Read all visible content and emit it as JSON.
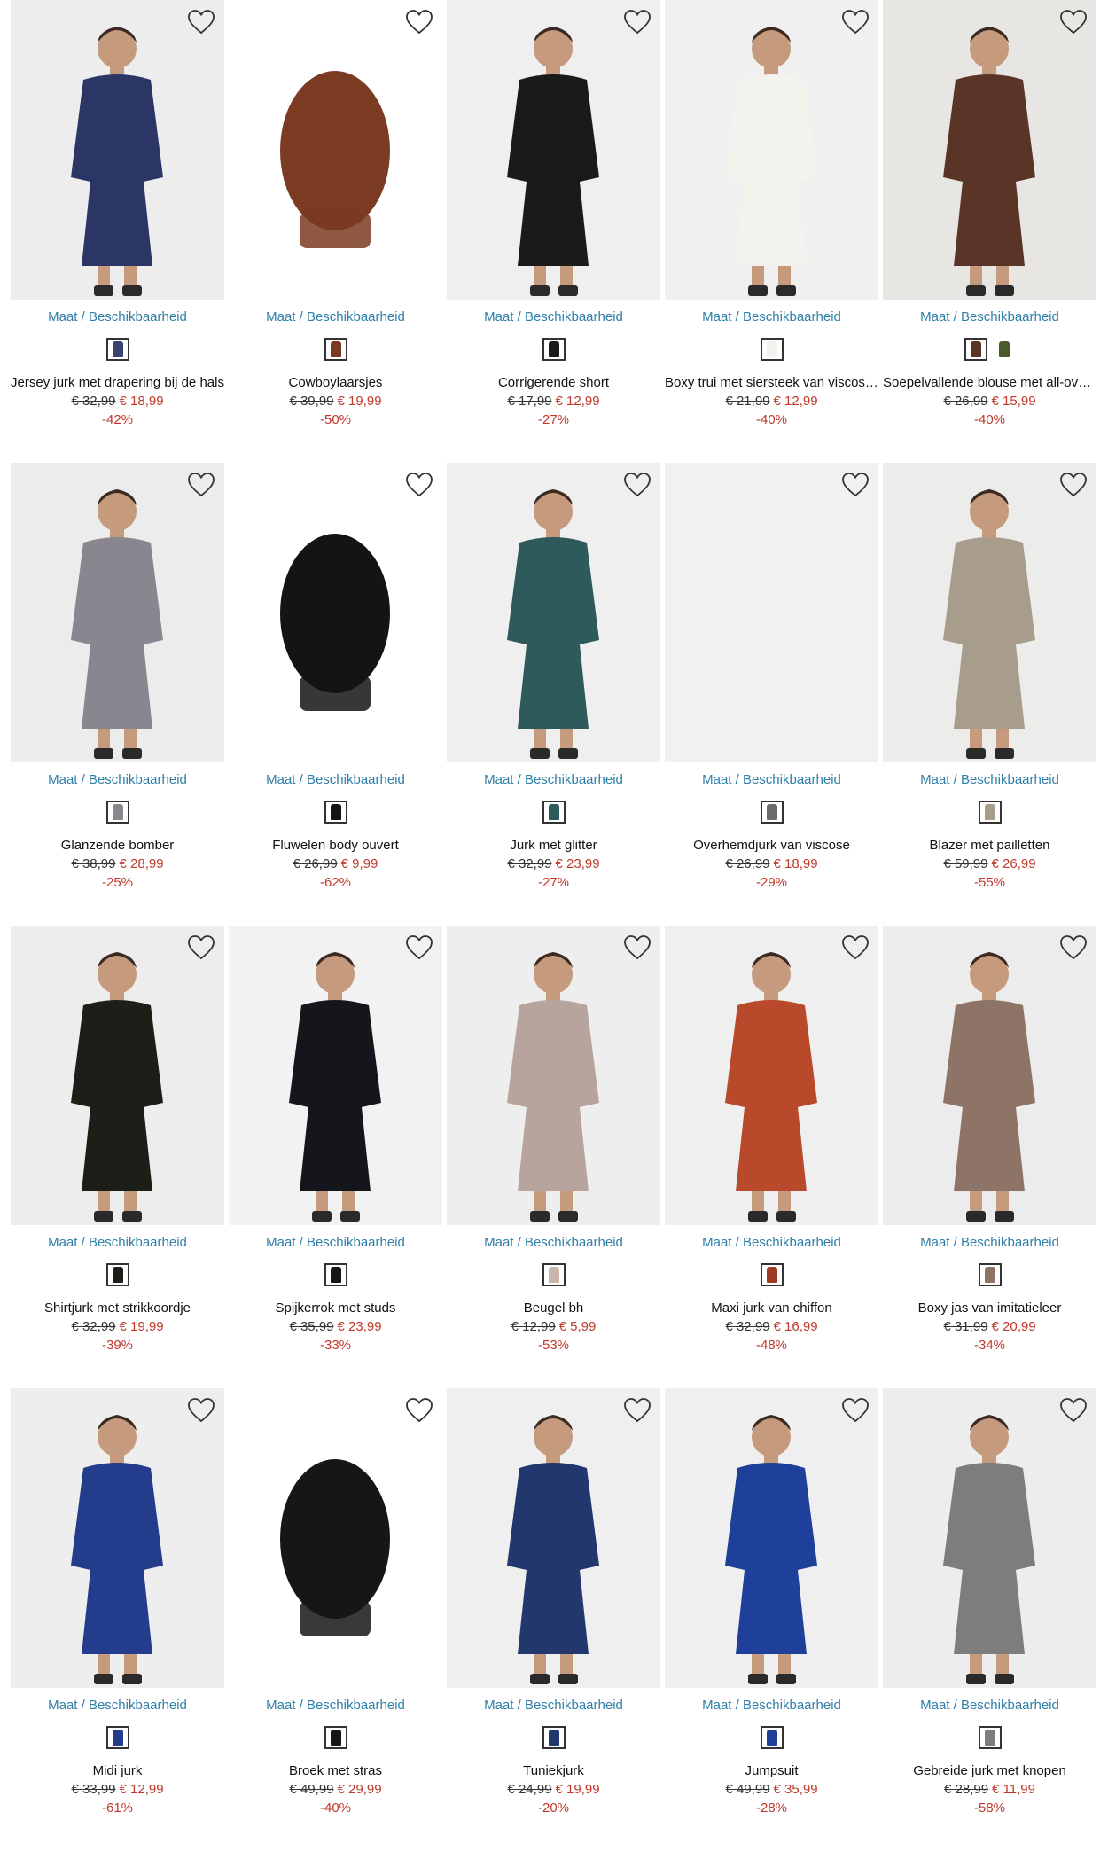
{
  "size_link_label": "Maat / Beschikbaarheid",
  "colors": {
    "link": "#2f7fa8",
    "price_new": "#c0392b",
    "discount": "#c0392b"
  },
  "icons": {
    "favorite": "heart-outline-icon"
  },
  "products": [
    {
      "name": "Jersey jurk met drapering bij de hals",
      "old_price": "€ 32,99",
      "new_price": "€ 18,99",
      "discount": "-42%",
      "image_bg": "#ededed",
      "garment": "#2b3566",
      "swatches": [
        "#3b4470"
      ]
    },
    {
      "name": "Cowboylaarsjes",
      "old_price": "€ 39,99",
      "new_price": "€ 19,99",
      "discount": "-50%",
      "image_bg": "#ffffff",
      "garment": "#7a3b22",
      "swatches": [
        "#7a3b22"
      ]
    },
    {
      "name": "Corrigerende short",
      "old_price": "€ 17,99",
      "new_price": "€ 12,99",
      "discount": "-27%",
      "image_bg": "#efefef",
      "garment": "#1a1a1a",
      "swatches": [
        "#1a1a1a"
      ]
    },
    {
      "name": "Boxy trui met siersteek van viscose...",
      "old_price": "€ 21,99",
      "new_price": "€ 12,99",
      "discount": "-40%",
      "image_bg": "#f0f0f0",
      "garment": "#f4f2ec",
      "swatches": [
        "#f4f2ec"
      ]
    },
    {
      "name": "Soepelvallende blouse met all-over ...",
      "old_price": "€ 26,99",
      "new_price": "€ 15,99",
      "discount": "-40%",
      "image_bg": "#e8e6e3",
      "garment": "#5a3427",
      "swatches": [
        "#5a3427",
        "#4a5a2a"
      ]
    },
    {
      "name": "Glanzende bomber",
      "old_price": "€ 38,99",
      "new_price": "€ 28,99",
      "discount": "-25%",
      "image_bg": "#ececec",
      "garment": "#8a8690",
      "swatches": [
        "#8a8690"
      ]
    },
    {
      "name": "Fluwelen body ouvert",
      "old_price": "€ 26,99",
      "new_price": "€ 9,99",
      "discount": "-62%",
      "image_bg": "#ffffff",
      "garment": "#141414",
      "swatches": [
        "#141414"
      ]
    },
    {
      "name": "Jurk met glitter",
      "old_price": "€ 32,99",
      "new_price": "€ 23,99",
      "discount": "-27%",
      "image_bg": "#efefef",
      "garment": "#2f5a5c",
      "swatches": [
        "#2f5a5c"
      ]
    },
    {
      "name": "Overhemdjurk van viscose",
      "old_price": "€ 26,99",
      "new_price": "€ 18,99",
      "discount": "-29%",
      "image_bg": "#f1f1f1",
      "garment": "#f1f1f1",
      "swatches": [
        "#6a6a6a"
      ]
    },
    {
      "name": "Blazer met pailletten",
      "old_price": "€ 59,99",
      "new_price": "€ 26,99",
      "discount": "-55%",
      "image_bg": "#ececea",
      "garment": "#a89c8c",
      "swatches": [
        "#a89c8c"
      ]
    },
    {
      "name": "Shirtjurk met strikkoordje",
      "old_price": "€ 32,99",
      "new_price": "€ 19,99",
      "discount": "-39%",
      "image_bg": "#ededed",
      "garment": "#1c1f18",
      "swatches": [
        "#1c1f18"
      ]
    },
    {
      "name": "Spijkerrok met studs",
      "old_price": "€ 35,99",
      "new_price": "€ 23,99",
      "discount": "-33%",
      "image_bg": "#f2f2f2",
      "garment": "#14161c",
      "swatches": [
        "#14161c"
      ]
    },
    {
      "name": "Beugel bh",
      "old_price": "€ 12,99",
      "new_price": "€ 5,99",
      "discount": "-53%",
      "image_bg": "#eeeeee",
      "garment": "#b7a49c",
      "swatches": [
        "#c9b6aa"
      ]
    },
    {
      "name": "Maxi jurk van chiffon",
      "old_price": "€ 32,99",
      "new_price": "€ 16,99",
      "discount": "-48%",
      "image_bg": "#efefef",
      "garment": "#b8492a",
      "swatches": [
        "#a13a25"
      ]
    },
    {
      "name": "Boxy jas van imitatieleer",
      "old_price": "€ 31,99",
      "new_price": "€ 20,99",
      "discount": "-34%",
      "image_bg": "#ececec",
      "garment": "#8e7466",
      "swatches": [
        "#8e7466"
      ]
    },
    {
      "name": "Midi jurk",
      "old_price": "€ 33,99",
      "new_price": "€ 12,99",
      "discount": "-61%",
      "image_bg": "#eeeeee",
      "garment": "#243c8c",
      "swatches": [
        "#243c8c"
      ]
    },
    {
      "name": "Broek met stras",
      "old_price": "€ 49,99",
      "new_price": "€ 29,99",
      "discount": "-40%",
      "image_bg": "#ffffff",
      "garment": "#161616",
      "swatches": [
        "#161616"
      ]
    },
    {
      "name": "Tuniekjurk",
      "old_price": "€ 24,99",
      "new_price": "€ 19,99",
      "discount": "-20%",
      "image_bg": "#efefef",
      "garment": "#22376e",
      "swatches": [
        "#22376e"
      ]
    },
    {
      "name": "Jumpsuit",
      "old_price": "€ 49,99",
      "new_price": "€ 35,99",
      "discount": "-28%",
      "image_bg": "#efefef",
      "garment": "#1e3f9a",
      "swatches": [
        "#1e3f9a"
      ]
    },
    {
      "name": "Gebreide jurk met knopen",
      "old_price": "€ 28,99",
      "new_price": "€ 11,99",
      "discount": "-58%",
      "image_bg": "#ededed",
      "garment": "#7d7d7d",
      "swatches": [
        "#7d7d7d"
      ]
    }
  ]
}
